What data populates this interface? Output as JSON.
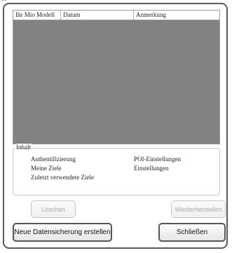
{
  "list": {
    "columns": [
      "Ihr Mio Modell",
      "Datum",
      "Anmerkung"
    ],
    "rows": []
  },
  "content_group": {
    "label": "Inhalt",
    "options": [
      "Authentifizierung",
      "Meine Ziele",
      "Zuletzt verwendete Ziele",
      "POI-Einstellungen",
      "Einstellungen"
    ]
  },
  "buttons": {
    "delete": "Löschen",
    "restore": "Wiederherstellen",
    "new_backup": "Neue Datensicherung erstellen",
    "close": "Schließen"
  },
  "colors": {
    "list_background": "#828282",
    "frame_border": "#5a5a5a",
    "disabled_text": "#a8a8a8"
  }
}
